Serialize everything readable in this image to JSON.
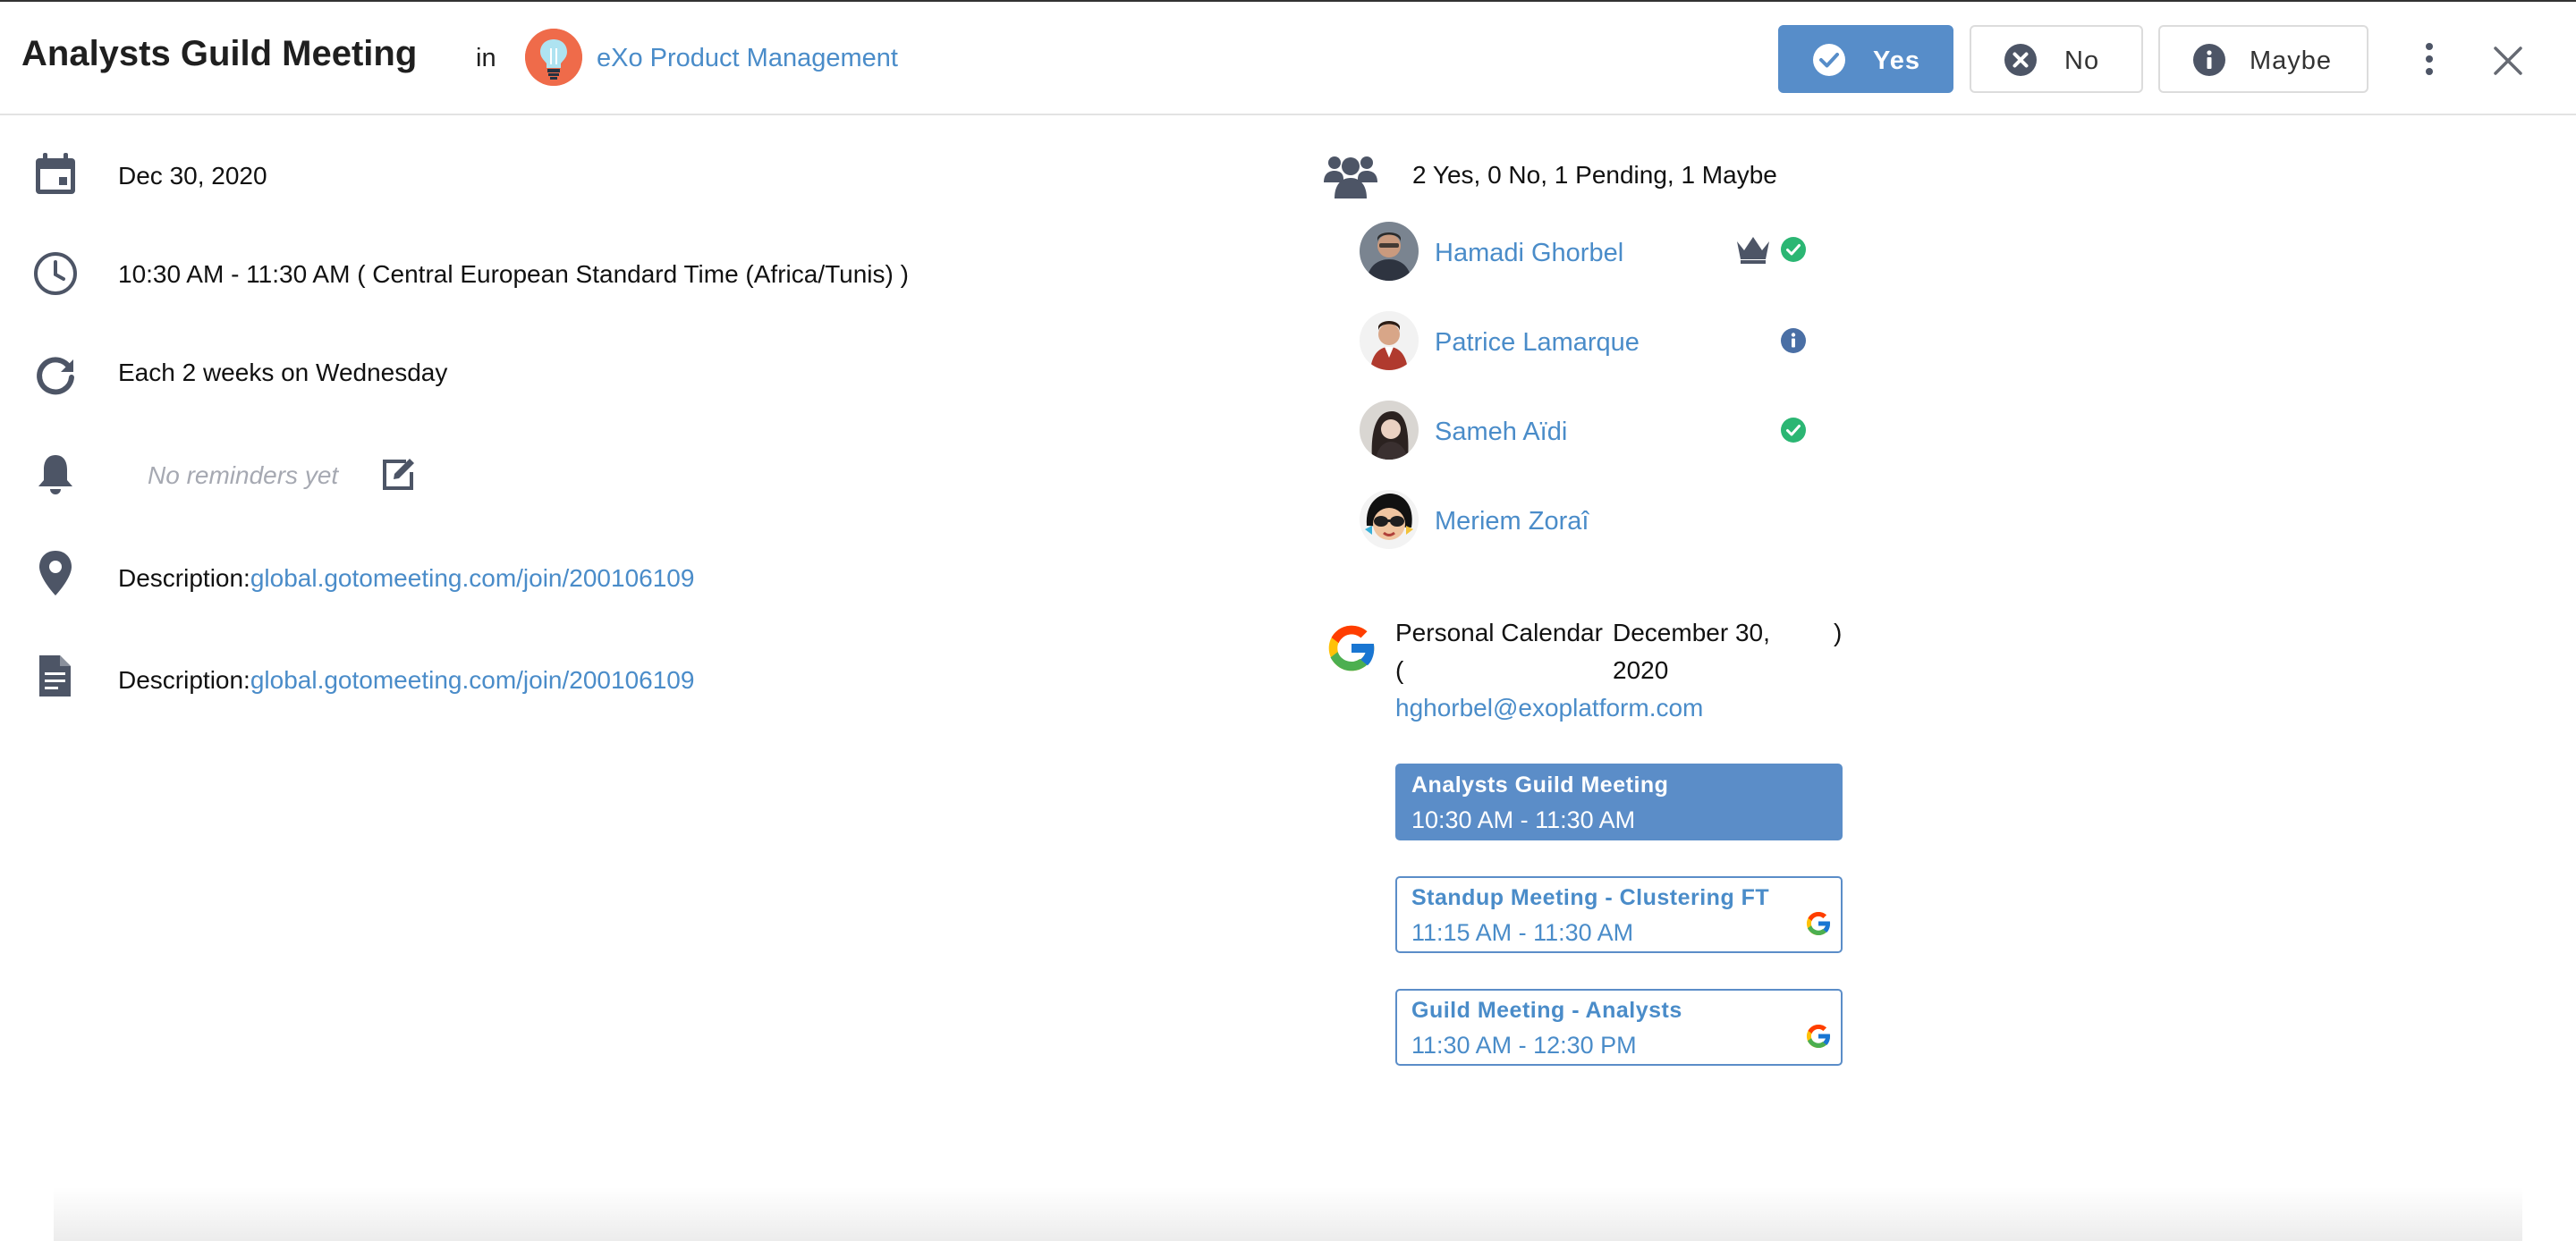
{
  "header": {
    "title": "Analysts Guild Meeting",
    "in_label": "in",
    "space_name": "eXo Product Management",
    "rsvp": {
      "yes": "Yes",
      "no": "No",
      "maybe": "Maybe"
    }
  },
  "details": {
    "date": "Dec 30, 2020",
    "time": "10:30 AM - 11:30 AM  ( Central European Standard Time (Africa/Tunis) )",
    "recurrence": "Each 2 weeks on Wednesday",
    "reminders": "No reminders yet",
    "location_label": "Description:",
    "location_link": "global.gotomeeting.com/join/200106109",
    "description_label": "Description:",
    "description_link": "global.gotomeeting.com/join/200106109"
  },
  "attendees": {
    "summary": "2 Yes, 0 No, 1 Pending, 1 Maybe",
    "list": [
      {
        "name": "Hamadi Ghorbel",
        "status": "yes",
        "organizer": true
      },
      {
        "name": "Patrice Lamarque",
        "status": "maybe",
        "organizer": false
      },
      {
        "name": "Sameh Aïdi",
        "status": "yes",
        "organizer": false
      },
      {
        "name": "Meriem Zoraî",
        "status": "pending",
        "organizer": false
      }
    ]
  },
  "personal_calendar": {
    "label": "Personal Calendar",
    "paren_open": "(",
    "date_line1": "December 30,",
    "date_line2": "2020",
    "paren_close": ")",
    "email": "hghorbel@exoplatform.com",
    "events": [
      {
        "title": "Analysts Guild Meeting",
        "time": "10:30 AM - 11:30 AM",
        "current": true
      },
      {
        "title": "Standup Meeting - Clustering FT",
        "time": "11:15 AM - 11:30 AM",
        "current": false
      },
      {
        "title": "Guild Meeting - Analysts",
        "time": "11:30 AM - 12:30 PM",
        "current": false
      }
    ]
  },
  "colors": {
    "accent": "#578dc9",
    "link": "#4a8cc9",
    "success": "#2bb673",
    "info": "#4a6fa5",
    "icon": "#4d5566",
    "space_avatar": "#ef6b4a"
  },
  "icons": {
    "date": "calendar-icon",
    "time": "clock-icon",
    "recurrence": "refresh-icon",
    "reminders": "bell-icon",
    "location": "map-pin-icon",
    "description": "document-icon",
    "attendees": "users-icon",
    "calendar_provider": "google-icon"
  }
}
